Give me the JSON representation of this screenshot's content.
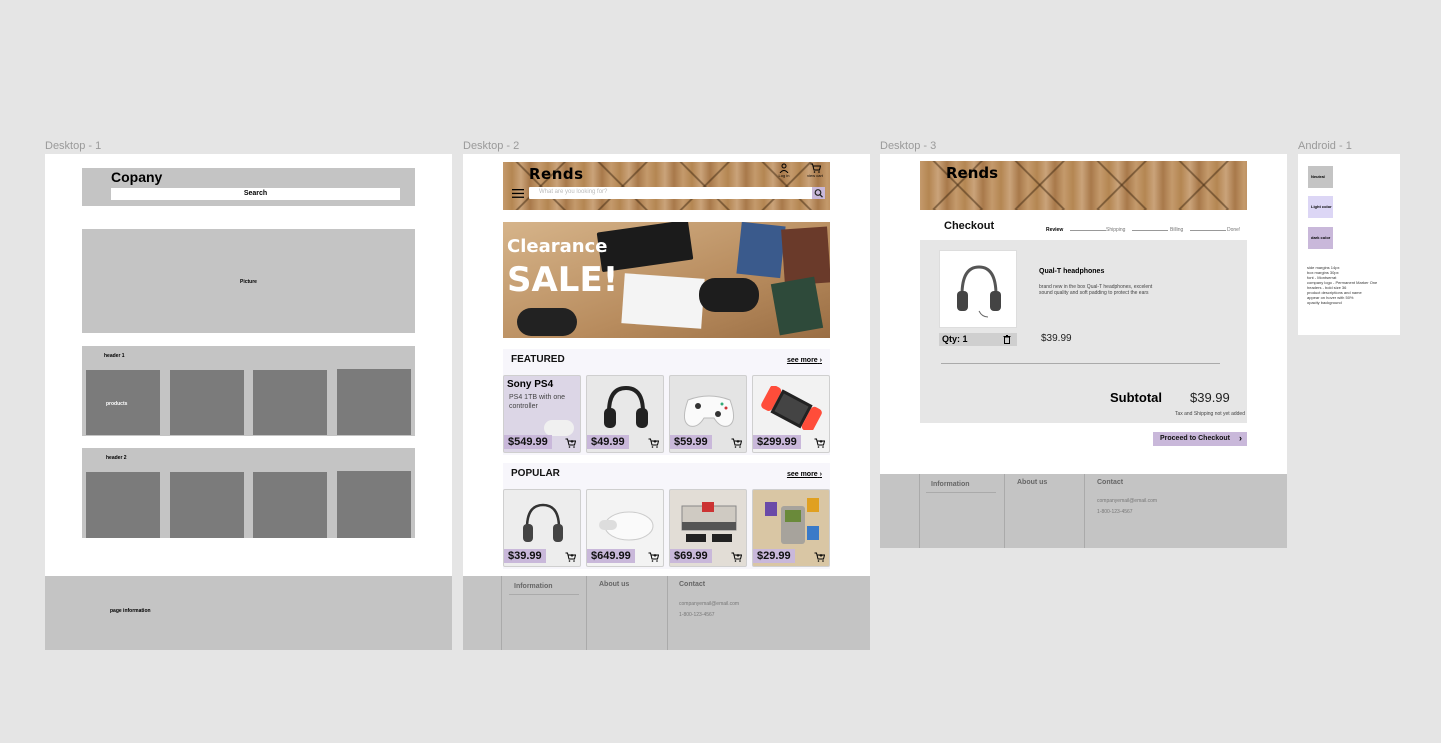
{
  "canvas": {
    "background": "#e5e5e5"
  },
  "frames": {
    "desktop1": {
      "label": "Desktop - 1",
      "header": {
        "title": "Copany",
        "search": "Search"
      },
      "hero": "Picture",
      "section1": {
        "header": "header 1",
        "first_card": "products"
      },
      "section2": {
        "header": "header 2"
      },
      "footer": "page information"
    },
    "desktop2": {
      "label": "Desktop - 2",
      "logo": "Rends",
      "login": "Log in",
      "view_cart": "view cart",
      "search_placeholder": "What are you looking for?",
      "banner": {
        "line1": "Clearance",
        "line2": "SALE!"
      },
      "featured": {
        "title": "FEATURED",
        "see_more": "see more",
        "first": {
          "name": "Sony PS4",
          "desc": "PS4 1TB with one controller"
        },
        "prices": [
          "$549.99",
          "$49.99",
          "$59.99",
          "$299.99"
        ],
        "items": [
          "ps4-controller",
          "wireless-headphones",
          "xbox-controller",
          "nintendo-switch"
        ]
      },
      "popular": {
        "title": "POPULAR",
        "see_more": "see more",
        "prices": [
          "$39.99",
          "$649.99",
          "$69.99",
          "$29.99"
        ],
        "items": [
          "wired-headphones",
          "vr-headset",
          "nes-console",
          "gameboy"
        ]
      },
      "footer": {
        "information": "Information",
        "about": "About us",
        "contact": "Contact",
        "email": "companyemail@email.com",
        "phone": "1-800-123-4567"
      }
    },
    "desktop3": {
      "label": "Desktop - 3",
      "logo": "Rends",
      "checkout_title": "Checkout",
      "steps": [
        "Review",
        "Shipping",
        "Billing",
        "Done!"
      ],
      "item": {
        "name": "Qual-T headphones",
        "desc": "brand new in the box Qual-T headphones, excelent sound quality and soft padding to protect the ears",
        "price": "$39.99",
        "qty": "Qty: 1"
      },
      "subtotal_label": "Subtotal",
      "subtotal_value": "$39.99",
      "tax_note": "Tax and Shipping not yet added",
      "proceed": "Proceed to Checkout",
      "footer": {
        "information": "Information",
        "about": "About us",
        "contact": "Contact",
        "email": "companyemail@email.com",
        "phone": "1-800-123-4567"
      }
    },
    "android1": {
      "label": "Android - 1",
      "swatches": [
        {
          "label": "Neutral",
          "color": "#c4c4c4"
        },
        {
          "label": "Light color",
          "color": "#dcd6f5"
        },
        {
          "label": "dark color",
          "color": "#c9b8da"
        }
      ],
      "notes": [
        "side margins 14px",
        "box margins 30px",
        "font - Montserrat",
        "company logo - Permanent Marker One",
        "headers - bold size 36",
        "product descriptions and name",
        "appear on hover with 50%",
        "opacity background"
      ]
    }
  },
  "colors": {
    "accent": "#c9b8da",
    "gray": "#c4c4c4",
    "dark_gray": "#7b7b7b"
  }
}
